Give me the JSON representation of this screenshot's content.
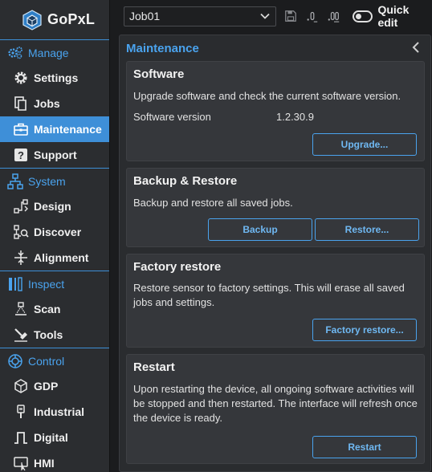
{
  "app": {
    "name": "GoPxL"
  },
  "sidebar": {
    "groups": [
      {
        "label": "Manage",
        "icon": "gears-icon",
        "items": [
          {
            "label": "Settings",
            "icon": "gear-icon"
          },
          {
            "label": "Jobs",
            "icon": "documents-icon"
          },
          {
            "label": "Maintenance",
            "icon": "toolbox-icon",
            "active": true
          },
          {
            "label": "Support",
            "icon": "question-icon"
          }
        ]
      },
      {
        "label": "System",
        "icon": "network-icon",
        "items": [
          {
            "label": "Design",
            "icon": "design-icon"
          },
          {
            "label": "Discover",
            "icon": "discover-icon"
          },
          {
            "label": "Alignment",
            "icon": "alignment-icon"
          }
        ]
      },
      {
        "label": "Inspect",
        "icon": "inspect-icon",
        "items": [
          {
            "label": "Scan",
            "icon": "scan-icon"
          },
          {
            "label": "Tools",
            "icon": "tools-icon"
          }
        ]
      },
      {
        "label": "Control",
        "icon": "control-icon",
        "items": [
          {
            "label": "GDP",
            "icon": "gdp-icon"
          },
          {
            "label": "Industrial",
            "icon": "industrial-icon"
          },
          {
            "label": "Digital",
            "icon": "digital-icon"
          },
          {
            "label": "HMI",
            "icon": "hmi-icon"
          }
        ]
      }
    ]
  },
  "toolbar": {
    "job": "Job01",
    "quick_edit_label": "Quick edit",
    "quick_edit_on": false
  },
  "main": {
    "title": "Maintenance",
    "software": {
      "title": "Software",
      "description": "Upgrade software and check the current software version.",
      "version_label": "Software version",
      "version_value": "1.2.30.9",
      "upgrade_button": "Upgrade..."
    },
    "backup": {
      "title": "Backup & Restore",
      "description": "Backup and restore all saved jobs.",
      "backup_button": "Backup",
      "restore_button": "Restore..."
    },
    "factory": {
      "title": "Factory restore",
      "description": "Restore sensor to factory settings. This will erase all saved jobs and settings.",
      "button": "Factory restore..."
    },
    "restart": {
      "title": "Restart",
      "description": "Upon restarting the device, all ongoing software activities will be stopped and then restarted. The interface will refresh once the device is ready.",
      "button": "Restart"
    }
  },
  "colors": {
    "accent": "#3e8fd8",
    "accent_text": "#4aa3ee",
    "sidebar_bg": "#2b2d30",
    "card_bg": "#35373b"
  }
}
